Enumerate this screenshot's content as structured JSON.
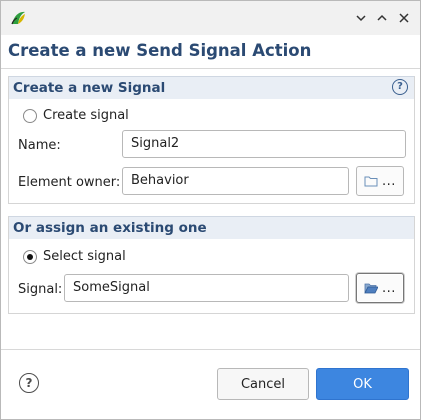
{
  "window": {
    "controls": {
      "minimize_icon": "chevron-down-icon",
      "maximize_icon": "chevron-up-icon",
      "close_icon": "close-icon"
    }
  },
  "dialog": {
    "title": "Create a new Send Signal Action"
  },
  "create_group": {
    "title": "Create a new Signal",
    "help_glyph": "?",
    "radio_label": "Create signal",
    "radio_checked": false,
    "name_label": "Name:",
    "name_value": "Signal2",
    "owner_label": "Element owner:",
    "owner_value": "Behavior",
    "browse_dots": "..."
  },
  "existing_group": {
    "title": "Or assign an existing one",
    "radio_label": "Select signal",
    "radio_checked": true,
    "signal_label": "Signal:",
    "signal_value": "SomeSignal",
    "browse_dots": "..."
  },
  "footer": {
    "help_glyph": "?",
    "cancel_label": "Cancel",
    "ok_label": "OK"
  },
  "colors": {
    "accent": "#3d86e0",
    "title": "#2b4a73",
    "group_header_bg": "#e9eef5"
  }
}
